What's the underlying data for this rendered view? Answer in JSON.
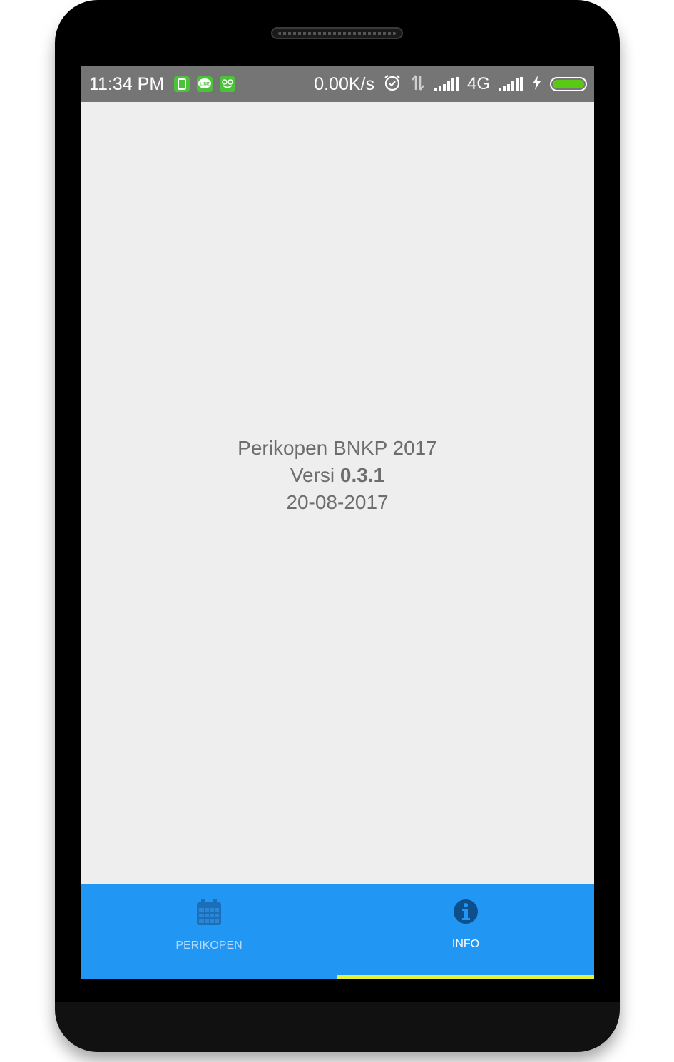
{
  "status_bar": {
    "time": "11:34 PM",
    "speed": "0.00K/s",
    "network": "4G",
    "notification_icons": [
      "clipboard-icon",
      "line-icon",
      "frog-icon"
    ],
    "line_icon_text": "LINE"
  },
  "info": {
    "app_name": "Perikopen BNKP 2017",
    "version_prefix": "Versi ",
    "version_number": "0.3.1",
    "date": "20-08-2017"
  },
  "bottom_nav": {
    "tabs": [
      {
        "label": "PERIKOPEN",
        "icon": "calendar-icon",
        "active": false
      },
      {
        "label": "INFO",
        "icon": "info-icon",
        "active": true
      }
    ]
  },
  "colors": {
    "status_bar": "#757575",
    "screen_bg": "#eeeeee",
    "nav_bg": "#2196f3",
    "indicator": "#e8ef3b",
    "battery": "#59c915"
  }
}
